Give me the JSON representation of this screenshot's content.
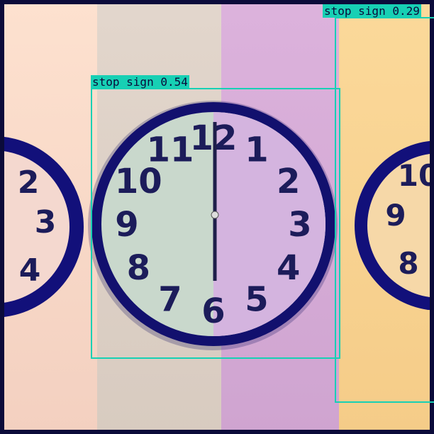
{
  "image": {
    "colors": {
      "frame": "#0b0b3a",
      "detection": "#17d0b4",
      "clock_rim": "#12107a",
      "numerals": "#1c1c5a"
    },
    "clock_numerals": [
      "12",
      "1",
      "2",
      "3",
      "4",
      "5",
      "6",
      "7",
      "8",
      "9",
      "10",
      "11"
    ],
    "clock_time": "6:00"
  },
  "detections": [
    {
      "label": "stop sign 0.54"
    },
    {
      "label": "stop sign 0.29"
    }
  ]
}
